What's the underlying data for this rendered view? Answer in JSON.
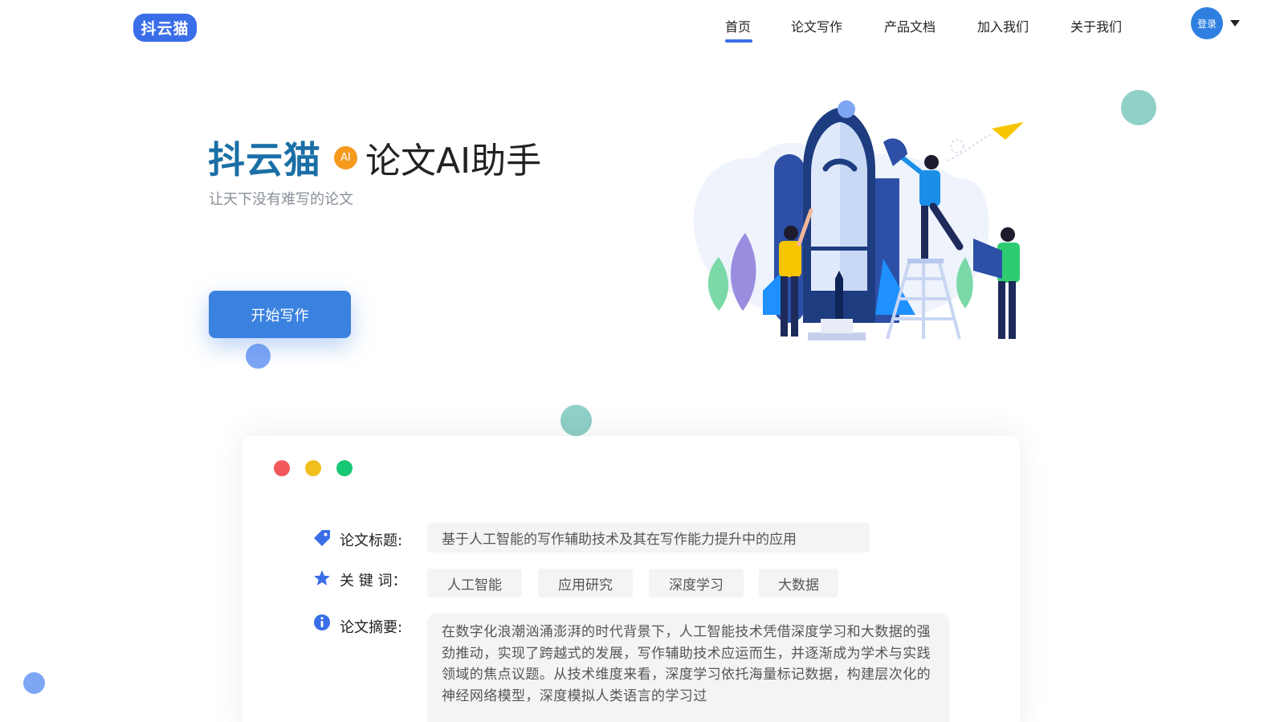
{
  "header": {
    "logo_text": "抖云猫",
    "nav": [
      {
        "label": "首页",
        "active": true
      },
      {
        "label": "论文写作",
        "active": false
      },
      {
        "label": "产品文档",
        "active": false
      },
      {
        "label": "加入我们",
        "active": false
      },
      {
        "label": "关于我们",
        "active": false
      }
    ],
    "login_label": "登录"
  },
  "hero": {
    "brand": "抖云猫",
    "badge": "AI",
    "title_rest": "论文AI助手",
    "subtitle": "让天下没有难写的论文",
    "start_button": "开始写作"
  },
  "card": {
    "title_label": "论文标题:",
    "title_value": "基于人工智能的写作辅助技术及其在写作能力提升中的应用",
    "keywords_label": "关 键 词：",
    "keywords": [
      "人工智能",
      "应用研究",
      "深度学习",
      "大数据"
    ],
    "abstract_label": "论文摘要:",
    "abstract_value": "在数字化浪潮汹涌澎湃的时代背景下，人工智能技术凭借深度学习和大数据的强劲推动，实现了跨越式的发展，写作辅助技术应运而生，并逐渐成为学术与实践领域的焦点议题。从技术维度来看，深度学习依托海量标记数据，构建层次化的神经网络模型，深度模拟人类语言的学习过"
  },
  "colors": {
    "primary": "#3a6ee8",
    "brand_text": "#1a6fa6",
    "badge": "#f59a1d",
    "teal_dot": "#8fd0c7",
    "blue_dot": "#7fa6f5",
    "win_red": "#f2585b",
    "win_yellow": "#f1be1e",
    "win_green": "#18c774"
  },
  "icons": {
    "title": "tag-icon",
    "keywords": "star-icon",
    "abstract": "info-icon"
  }
}
